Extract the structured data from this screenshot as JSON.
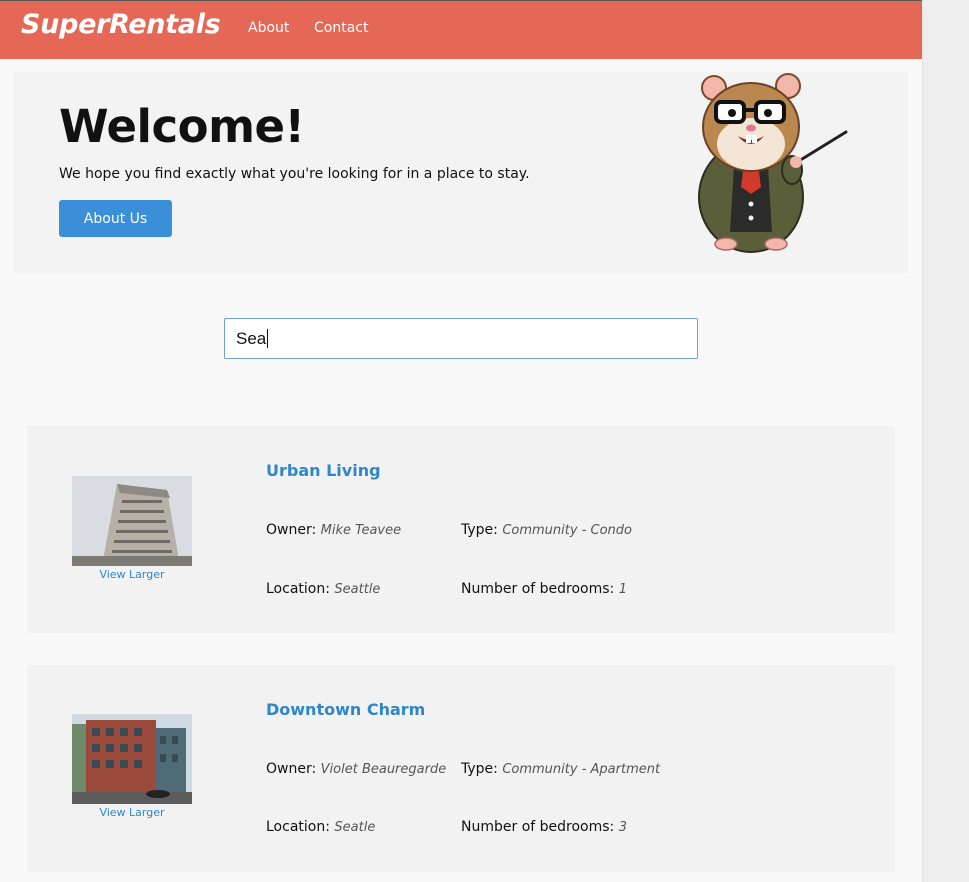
{
  "navbar": {
    "brand": "SuperRentals",
    "links": [
      {
        "label": "About"
      },
      {
        "label": "Contact"
      }
    ],
    "color": "#e46855"
  },
  "jumbo": {
    "heading": "Welcome!",
    "tagline": "We hope you find exactly what you're looking for in a place to stay.",
    "button_label": "About Us",
    "mascot_icon": "tomster-hamster-teacher-icon"
  },
  "search": {
    "value": "Sea"
  },
  "listings": [
    {
      "title": "Urban Living",
      "view_larger": "View Larger",
      "owner_label": "Owner:",
      "owner": "Mike Teavee",
      "type_label": "Type:",
      "type": "Community - Condo",
      "location_label": "Location:",
      "location": "Seattle",
      "bedrooms_label": "Number of bedrooms:",
      "bedrooms": "1"
    },
    {
      "title": "Downtown Charm",
      "view_larger": "View Larger",
      "owner_label": "Owner:",
      "owner": "Violet Beauregarde",
      "type_label": "Type:",
      "type": "Community - Apartment",
      "location_label": "Location:",
      "location": "Seatle",
      "bedrooms_label": "Number of bedrooms:",
      "bedrooms": "3"
    }
  ],
  "colors": {
    "accent": "#3a8fd8",
    "link": "#2f86cc"
  }
}
